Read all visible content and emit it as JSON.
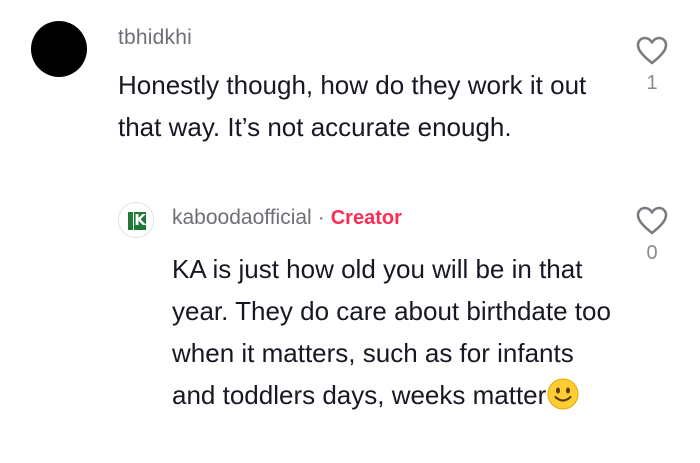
{
  "comment": {
    "username": "tbhidkhi",
    "text": "Honestly though, how do they work it out that way. It’s not accurate enough.",
    "like_count": "1",
    "like_icon": "heart-outline-icon"
  },
  "reply": {
    "username": "kaboodaofficial",
    "separator": "·",
    "badge": "Creator",
    "text": "KA is just how old you will be in that year. They do care about birthdate too when it matters, such as for infants and toddlers days, weeks matter",
    "emoji": "slightly-smiling-face-emoji",
    "like_count": "0",
    "like_icon": "heart-outline-icon",
    "avatar_logo": "kabooda-logo"
  },
  "colors": {
    "username": "#6e6f76",
    "body_text": "#161823",
    "creator_badge": "#fe2c55",
    "logo_green": "#1f7a35",
    "emoji_yellow": "#ffcc33"
  }
}
